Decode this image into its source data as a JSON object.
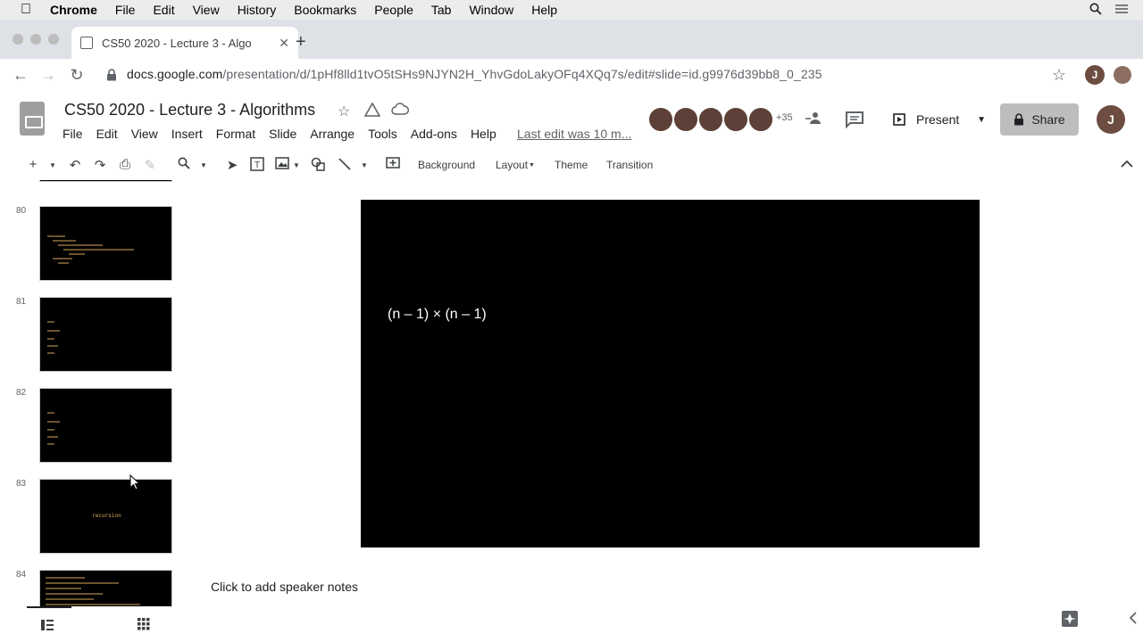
{
  "mac_menu": {
    "apple_icon": "apple-icon",
    "items": [
      "Chrome",
      "File",
      "Edit",
      "View",
      "History",
      "Bookmarks",
      "People",
      "Tab",
      "Window",
      "Help"
    ]
  },
  "browser": {
    "tab_title": "CS50 2020 - Lecture 3 - Algo",
    "url_host": "docs.google.com",
    "url_path": "/presentation/d/1pHf8lld1tvO5tSHs9NJYN2H_YhvGdoLakyOFq4XQq7s/edit#slide=id.g9976d39bb8_0_235",
    "profile_initial": "J"
  },
  "docs": {
    "title": "CS50 2020 - Lecture 3 - Algorithms",
    "menu": [
      "File",
      "Edit",
      "View",
      "Insert",
      "Format",
      "Slide",
      "Arrange",
      "Tools",
      "Add-ons",
      "Help"
    ],
    "last_edit": "Last edit was 10 m...",
    "collaborators_more": "+35",
    "present_label": "Present",
    "share_label": "Share",
    "user_initial": "J"
  },
  "toolbar": {
    "background": "Background",
    "layout": "Layout",
    "theme": "Theme",
    "transition": "Transition"
  },
  "filmstrip": {
    "slides": [
      {
        "number": "80"
      },
      {
        "number": "81"
      },
      {
        "number": "82"
      },
      {
        "number": "83",
        "text": "recursion"
      },
      {
        "number": "84"
      }
    ]
  },
  "slide": {
    "formula": "(n – 1) × (n – 1)"
  },
  "notes": {
    "placeholder": "Click to add speaker notes"
  }
}
